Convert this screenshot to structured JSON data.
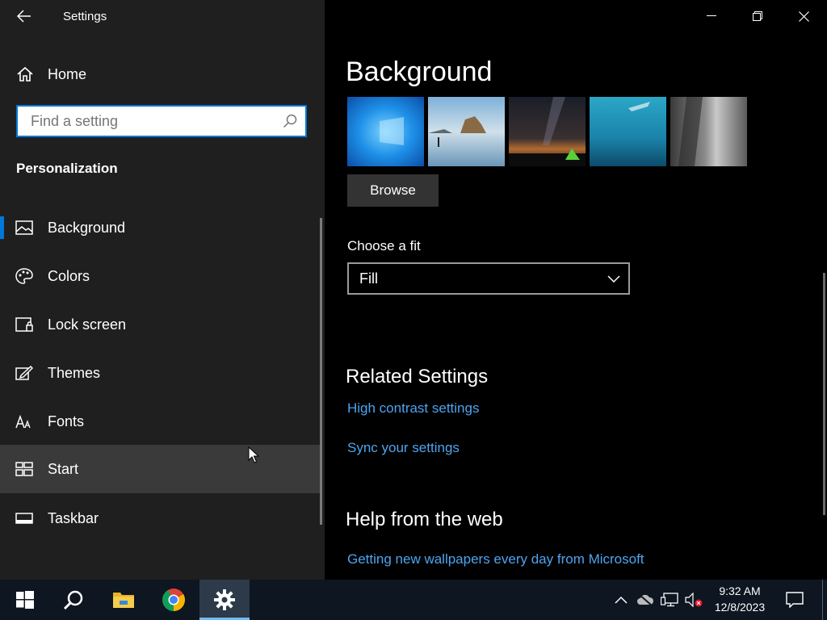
{
  "window": {
    "title": "Settings"
  },
  "sidebar": {
    "home_label": "Home",
    "search_placeholder": "Find a setting",
    "section_title": "Personalization",
    "items": [
      {
        "label": "Background",
        "icon": "picture-icon",
        "selected": true
      },
      {
        "label": "Colors",
        "icon": "palette-icon"
      },
      {
        "label": "Lock screen",
        "icon": "lock-screen-icon"
      },
      {
        "label": "Themes",
        "icon": "themes-icon"
      },
      {
        "label": "Fonts",
        "icon": "fonts-icon"
      },
      {
        "label": "Start",
        "icon": "start-icon",
        "hover": true
      },
      {
        "label": "Taskbar",
        "icon": "taskbar-icon"
      }
    ]
  },
  "main": {
    "title": "Background",
    "browse_label": "Browse",
    "fit_label": "Choose a fit",
    "fit_value": "Fill",
    "related_title": "Related Settings",
    "related_links": [
      "High contrast settings",
      "Sync your settings"
    ],
    "help_title": "Help from the web",
    "help_links": [
      "Getting new wallpapers every day from Microsoft"
    ]
  },
  "taskbar": {
    "time": "9:32 AM",
    "date": "12/8/2023",
    "apps": [
      "start-icon",
      "search-icon",
      "file-explorer-icon",
      "chrome-icon",
      "settings-gear-icon"
    ]
  },
  "colors": {
    "accent": "#0078d7",
    "link": "#4ea4f0",
    "sidebar_bg": "#1f1f1f"
  }
}
